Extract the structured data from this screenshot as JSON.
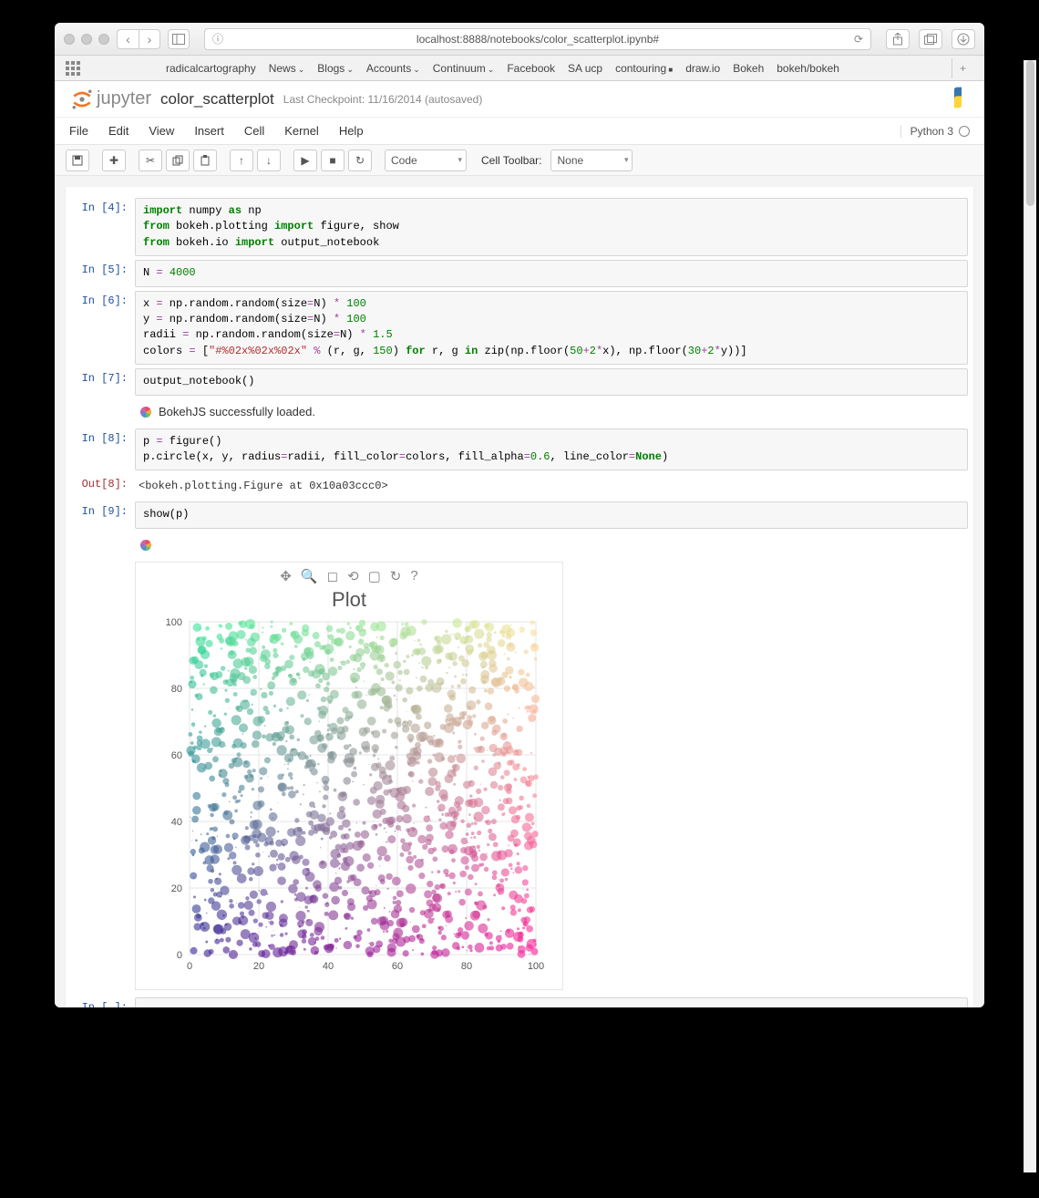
{
  "browser": {
    "url": "localhost:8888/notebooks/color_scatterplot.ipynb#",
    "bookmarks": [
      "radicalcartography",
      "News",
      "Blogs",
      "Accounts",
      "Continuum",
      "Facebook",
      "SA ucp",
      "contouring",
      "draw.io",
      "Bokeh",
      "bokeh/bokeh"
    ],
    "bookmark_dropdowns": [
      false,
      true,
      true,
      true,
      true,
      false,
      false,
      false,
      false,
      false,
      false
    ]
  },
  "notebook": {
    "logo_text": "jupyter",
    "name": "color_scatterplot",
    "checkpoint": "Last Checkpoint: 11/16/2014 (autosaved)",
    "kernel": "Python 3"
  },
  "menus": [
    "File",
    "Edit",
    "View",
    "Insert",
    "Cell",
    "Kernel",
    "Help"
  ],
  "toolbar": {
    "celltype": "Code",
    "celltoolbar_label": "Cell Toolbar:",
    "celltoolbar_value": "None"
  },
  "cells": [
    {
      "n": "4",
      "prompt": "In [4]:",
      "code_html": "<span class='kw'>import</span> numpy <span class='kw'>as</span> np\n<span class='kw'>from</span> bokeh.plotting <span class='kw'>import</span> figure, show\n<span class='kw'>from</span> bokeh.io <span class='kw'>import</span> output_notebook"
    },
    {
      "n": "5",
      "prompt": "In [5]:",
      "code_html": "N <span class='op'>=</span> <span class='num'>4000</span>"
    },
    {
      "n": "6",
      "prompt": "In [6]:",
      "code_html": "x <span class='op'>=</span> np.random.random(size<span class='op'>=</span>N) <span class='op'>*</span> <span class='num'>100</span>\ny <span class='op'>=</span> np.random.random(size<span class='op'>=</span>N) <span class='op'>*</span> <span class='num'>100</span>\nradii <span class='op'>=</span> np.random.random(size<span class='op'>=</span>N) <span class='op'>*</span> <span class='num'>1.5</span>\ncolors <span class='op'>=</span> [<span class='str'>\"#%02x%02x%02x\"</span> <span class='op'>%</span> (r, g, <span class='num'>150</span>) <span class='kw'>for</span> r, g <span class='kw'>in</span> zip(np.floor(<span class='num'>50</span><span class='op'>+</span><span class='num'>2</span><span class='op'>*</span>x), np.floor(<span class='num'>30</span><span class='op'>+</span><span class='num'>2</span><span class='op'>*</span>y))]"
    },
    {
      "n": "7",
      "prompt": "In [7]:",
      "code_html": "output_notebook()",
      "output_badge": "BokehJS successfully loaded."
    },
    {
      "n": "8",
      "prompt": "In [8]:",
      "code_html": "p <span class='op'>=</span> figure()\np.circle(x, y, radius<span class='op'>=</span>radii, fill_color<span class='op'>=</span>colors, fill_alpha<span class='op'>=</span><span class='num'>0.6</span>, line_color<span class='op'>=</span><span class='kw2'>None</span>)",
      "out_prompt": "Out[8]:",
      "output": "<bokeh.plotting.Figure at 0x10a03ccc0>"
    },
    {
      "n": "9",
      "prompt": "In [9]:",
      "code_html": "show(p)",
      "has_plot": true
    },
    {
      "n": "",
      "prompt": "In [ ]:",
      "code_html": ""
    }
  ],
  "chart_data": {
    "type": "scatter",
    "title": "Plot",
    "xlabel": "",
    "ylabel": "",
    "xlim": [
      0,
      100
    ],
    "ylim": [
      0,
      100
    ],
    "xticks": [
      0,
      20,
      40,
      60,
      80,
      100
    ],
    "yticks": [
      0,
      20,
      40,
      60,
      80,
      100
    ],
    "N": 4000,
    "radius_range": [
      0,
      1.5
    ],
    "color_formula": "rgb(floor(50+2*x), floor(30+2*y), 150)",
    "fill_alpha": 0.6,
    "note": "x,y uniform random in [0,100]; random radii 0–1.5; colors derived from x,y per formula"
  }
}
